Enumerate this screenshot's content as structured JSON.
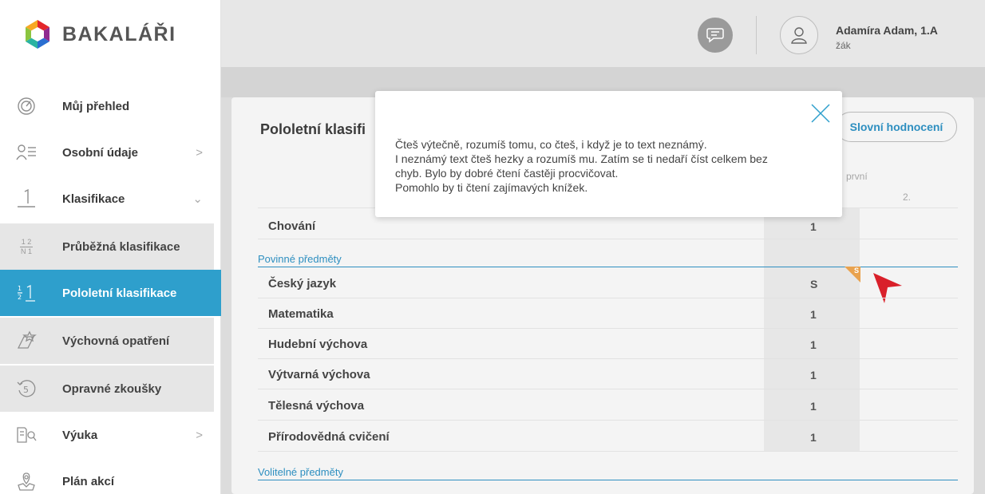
{
  "app": {
    "name": "BAKALÁŘI"
  },
  "sidebar": {
    "items": [
      {
        "label": "Můj přehled",
        "icon": "gauge-icon"
      },
      {
        "label": "Osobní údaje",
        "icon": "person-card-icon",
        "chevron": ">"
      },
      {
        "label": "Klasifikace",
        "icon": "grade-one-icon",
        "chevron": "⌄"
      },
      {
        "label": "Průběžná klasifikace",
        "icon": "fraction-icon",
        "fraction_top": "1 2",
        "fraction_bottom": "N 1"
      },
      {
        "label": "Pololetní klasifikace",
        "icon": "half-one-icon",
        "active": true
      },
      {
        "label": "Výchovná opatření",
        "icon": "award-icon"
      },
      {
        "label": "Opravné zkoušky",
        "icon": "retry-five-icon",
        "badge": "5"
      },
      {
        "label": "Výuka",
        "icon": "book-search-icon",
        "chevron": ">"
      },
      {
        "label": "Plán akcí",
        "icon": "map-pin-icon"
      }
    ]
  },
  "topbar": {
    "message_icon": "message-icon",
    "avatar_icon": "user-icon",
    "user_name": "Adamíra Adam, 1.A",
    "user_role": "žák"
  },
  "main": {
    "title": "Pololetní klasifi",
    "verbal_button": "Slovní hodnocení",
    "header_period": "první",
    "header_col": "2.",
    "rows": [
      {
        "label": "Chování",
        "grade": "1"
      },
      {
        "label": "Český jazyk",
        "grade": "S",
        "corner_mark": "S"
      },
      {
        "label": "Matematika",
        "grade": "1"
      },
      {
        "label": "Hudební výchova",
        "grade": "1"
      },
      {
        "label": "Výtvarná výchova",
        "grade": "1"
      },
      {
        "label": "Tělesná výchova",
        "grade": "1"
      },
      {
        "label": "Přírodovědná cvičení",
        "grade": "1"
      }
    ],
    "sections": {
      "mandatory": "Povinné předměty",
      "optional": "Volitelné předměty"
    }
  },
  "modal": {
    "lines": [
      "Čteš výtečně, rozumíš tomu, co čteš, i když je to text neznámý.",
      "I neznámý text čteš hezky a rozumíš mu. Zatím se ti nedaří číst celkem bez",
      "chyb. Bylo by dobré čtení častěji procvičovat.",
      "Pomohlo by ti čtení zajímavých knížek."
    ],
    "close_icon": "close-icon"
  },
  "colors": {
    "accent": "#2e9fcc",
    "link": "#2e8fc0",
    "corner": "#e9a24e",
    "pointer": "#d9202a"
  }
}
